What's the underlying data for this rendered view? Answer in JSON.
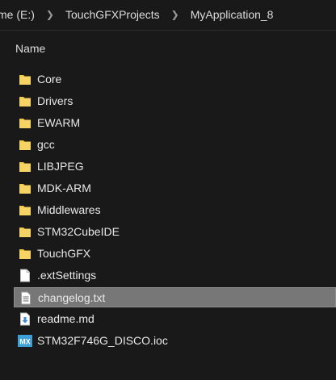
{
  "breadcrumb": {
    "items": [
      "me (E:)",
      "TouchGFXProjects",
      "MyApplication_8"
    ]
  },
  "columns": {
    "name": "Name"
  },
  "files": [
    {
      "name": "Core",
      "icon": "folder-icon"
    },
    {
      "name": "Drivers",
      "icon": "folder-icon"
    },
    {
      "name": "EWARM",
      "icon": "folder-icon"
    },
    {
      "name": "gcc",
      "icon": "folder-icon"
    },
    {
      "name": "LIBJPEG",
      "icon": "folder-icon"
    },
    {
      "name": "MDK-ARM",
      "icon": "folder-icon"
    },
    {
      "name": "Middlewares",
      "icon": "folder-icon"
    },
    {
      "name": "STM32CubeIDE",
      "icon": "folder-icon"
    },
    {
      "name": "TouchGFX",
      "icon": "folder-icon"
    },
    {
      "name": ".extSettings",
      "icon": "file-icon"
    },
    {
      "name": "changelog.txt",
      "icon": "text-file-icon",
      "selected": true
    },
    {
      "name": "readme.md",
      "icon": "markdown-file-icon"
    },
    {
      "name": "STM32F746G_DISCO.ioc",
      "icon": "mx-file-icon",
      "icon_text": "MX"
    }
  ],
  "colors": {
    "background": "#191919",
    "folder": "#f3c94d",
    "selection": "#777777",
    "mx_icon": "#3d9fd6",
    "markdown_arrow": "#3c8ad8"
  }
}
